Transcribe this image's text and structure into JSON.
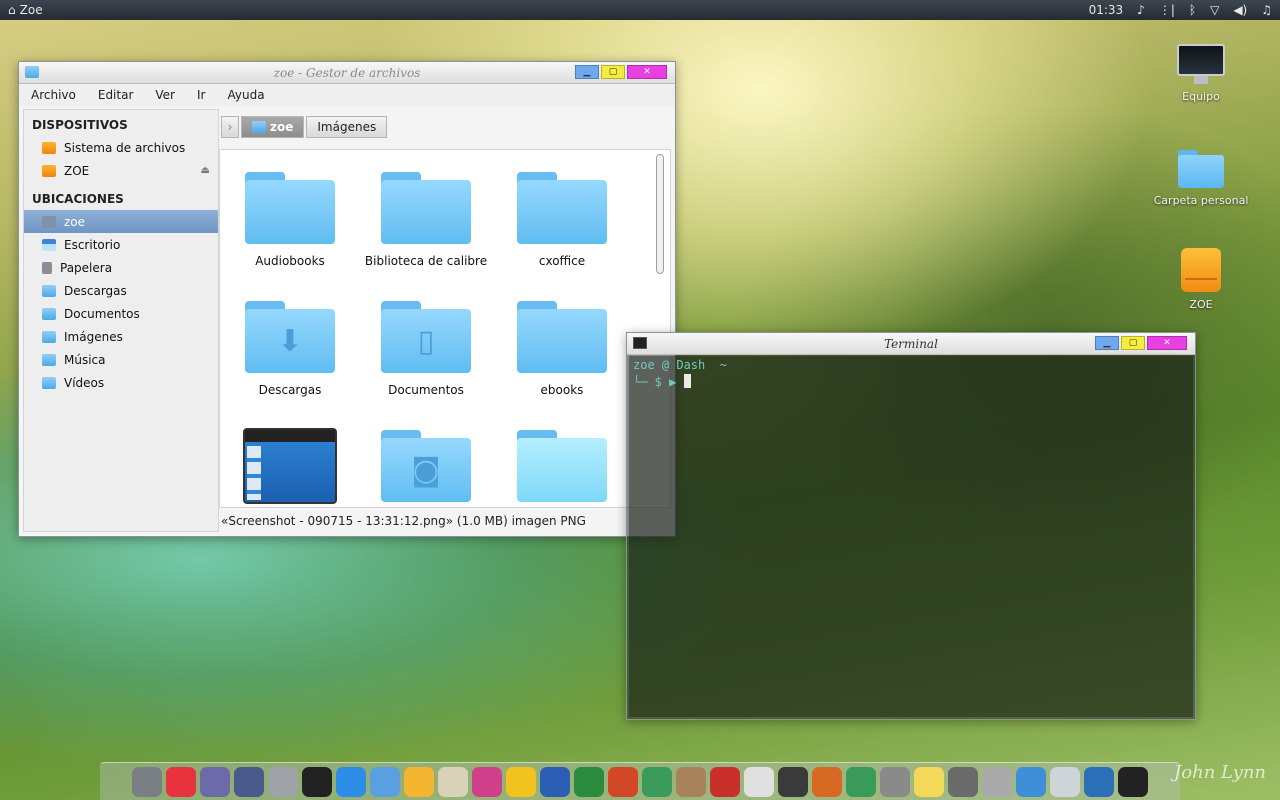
{
  "top_panel": {
    "app_name": "Zoe",
    "clock": "01:33",
    "icons": [
      "music-note-icon",
      "network-bars-icon",
      "bluetooth-icon",
      "wifi-icon",
      "volume-icon",
      "bell-icon"
    ]
  },
  "desktop_icons": [
    {
      "label": "Equipo",
      "icon": "computer-icon"
    },
    {
      "label": "Carpeta personal",
      "icon": "home-folder-icon"
    },
    {
      "label": "ZOE",
      "icon": "usb-drive-icon"
    }
  ],
  "file_manager": {
    "title": "zoe - Gestor de archivos",
    "menu": [
      "Archivo",
      "Editar",
      "Ver",
      "Ir",
      "Ayuda"
    ],
    "sidebar": {
      "devices_heading": "DISPOSITIVOS",
      "devices": [
        "Sistema de archivos",
        "ZOE"
      ],
      "places_heading": "UBICACIONES",
      "places": [
        "zoe",
        "Escritorio",
        "Papelera",
        "Descargas",
        "Documentos",
        "Imágenes",
        "Música",
        "Vídeos"
      ],
      "selected": "zoe"
    },
    "breadcrumbs": [
      "zoe",
      "Imágenes"
    ],
    "items": [
      {
        "label": "Audiobooks",
        "icon": "folder-icon"
      },
      {
        "label": "Biblioteca de calibre",
        "icon": "folder-icon"
      },
      {
        "label": "cxoffice",
        "icon": "folder-icon"
      },
      {
        "label": "Descargas",
        "icon": "download-folder-icon"
      },
      {
        "label": "Documentos",
        "icon": "documents-folder-icon"
      },
      {
        "label": "ebooks",
        "icon": "folder-icon"
      },
      {
        "label": "",
        "icon": "application-icon"
      },
      {
        "label": "",
        "icon": "pictures-folder-icon"
      },
      {
        "label": "",
        "icon": "folder-icon"
      }
    ],
    "status": "«Screenshot - 090715 - 13:31:12.png» (1.0 MB) imagen PNG"
  },
  "terminal": {
    "title": "Terminal",
    "line1": "zoe @ Dash  ~",
    "line2": "└─ $ ▶ "
  },
  "dock": {
    "items": [
      {
        "icon": "rocket-icon",
        "color": "#7a7f86"
      },
      {
        "icon": "music-icon",
        "color": "#e8333f"
      },
      {
        "icon": "files-icon",
        "color": "#6c6aa8"
      },
      {
        "icon": "sync-icon",
        "color": "#4b5a8c"
      },
      {
        "icon": "settings-ring-icon",
        "color": "#9ea3a8"
      },
      {
        "icon": "terminal-icon",
        "color": "#222222"
      },
      {
        "icon": "app-store-icon",
        "color": "#2d8ee8"
      },
      {
        "icon": "archive-icon",
        "color": "#5aa0e0"
      },
      {
        "icon": "sketch-icon",
        "color": "#f4b630"
      },
      {
        "icon": "inkscape-icon",
        "color": "#d8d2b8"
      },
      {
        "icon": "audio-wave-icon",
        "color": "#d0408a"
      },
      {
        "icon": "emoji-icon",
        "color": "#f2c31e"
      },
      {
        "icon": "word-icon",
        "color": "#2b5fb4"
      },
      {
        "icon": "excel-icon",
        "color": "#2a8a3e"
      },
      {
        "icon": "powerpoint-icon",
        "color": "#d24726"
      },
      {
        "icon": "usb-icon",
        "color": "#3a9a5a"
      },
      {
        "icon": "contacts-icon",
        "color": "#a8825a"
      },
      {
        "icon": "presentation-icon",
        "color": "#c9302c"
      },
      {
        "icon": "text-editor-icon",
        "color": "#e0e0e0"
      },
      {
        "icon": "magic-wand-icon",
        "color": "#3a3a3a"
      },
      {
        "icon": "bird-icon",
        "color": "#d66a22"
      },
      {
        "icon": "usb-green-icon",
        "color": "#3a9a5a"
      },
      {
        "icon": "notebook-icon",
        "color": "#8a8a8a"
      },
      {
        "icon": "notes-icon",
        "color": "#f4d85a"
      },
      {
        "icon": "system-prefs-icon",
        "color": "#6a6a6a"
      },
      {
        "icon": "back-icon",
        "color": "#aaaaaa"
      },
      {
        "icon": "anchor-icon",
        "color": "#3d8fd8"
      },
      {
        "icon": "trash-icon",
        "color": "#cfd4d8"
      },
      {
        "icon": "monitor-icon",
        "color": "#2a6fb8"
      },
      {
        "icon": "terminal-icon",
        "color": "#222222"
      }
    ]
  },
  "signature": "John Lynn"
}
